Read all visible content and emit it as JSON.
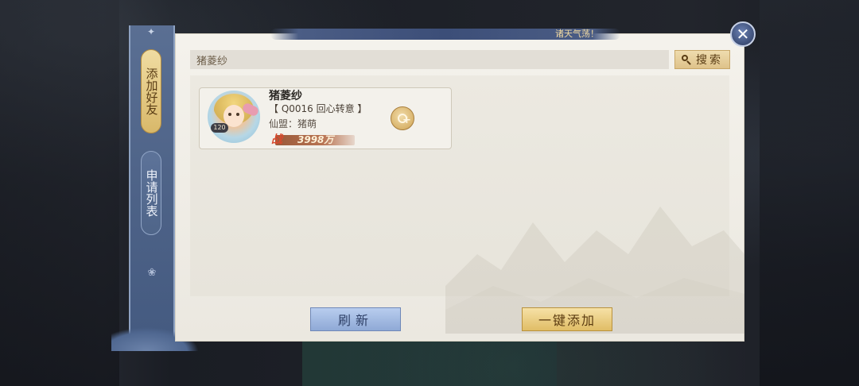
{
  "header": {
    "banner_text": "诸天气荡！"
  },
  "tabs": [
    {
      "label": "添加好友",
      "active": true
    },
    {
      "label": "申请列表",
      "active": false
    }
  ],
  "search": {
    "value": "猪菱纱",
    "button_label": "搜索"
  },
  "results": [
    {
      "name": "猪菱纱",
      "title": "【 Q0016 回心转意 】",
      "guild": "仙盟：猪萌",
      "level": "120",
      "power_icon": "战",
      "power": "3998万"
    }
  ],
  "footer": {
    "refresh_label": "刷新",
    "add_all_label": "一键添加"
  },
  "colors": {
    "panel_bg": "#f4f2ec",
    "tab_active": "#e3c77f",
    "tab_rail": "#52678c",
    "refresh_btn": "#a3bbe2",
    "add_all_btn": "#ebcd80"
  }
}
